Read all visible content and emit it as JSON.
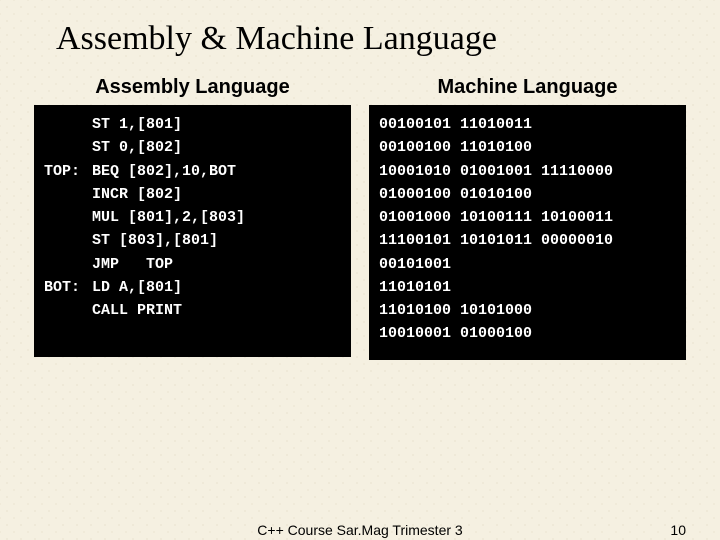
{
  "title": "Assembly & Machine Language",
  "left_header": "Assembly Language",
  "right_header": "Machine Language",
  "assembly": [
    {
      "label": "",
      "instr": "ST 1,[801]"
    },
    {
      "label": "",
      "instr": "ST 0,[802]"
    },
    {
      "label": "TOP:",
      "instr": "BEQ [802],10,BOT"
    },
    {
      "label": "",
      "instr": "INCR [802]"
    },
    {
      "label": "",
      "instr": "MUL [801],2,[803]"
    },
    {
      "label": "",
      "instr": "ST [803],[801]"
    },
    {
      "label": "",
      "instr": "JMP   TOP"
    },
    {
      "label": "BOT:",
      "instr": "LD A,[801]"
    },
    {
      "label": "",
      "instr": "CALL PRINT"
    }
  ],
  "machine": [
    "00100101 11010011",
    "00100100 11010100",
    "10001010 01001001 11110000",
    "01000100 01010100",
    "01001000 10100111 10100011",
    "11100101 10101011 00000010",
    "00101001",
    "11010101",
    "11010100 10101000",
    "10010001 01000100"
  ],
  "footer_center": "C++   Course Sar.Mag Trimester 3",
  "footer_right": "10"
}
